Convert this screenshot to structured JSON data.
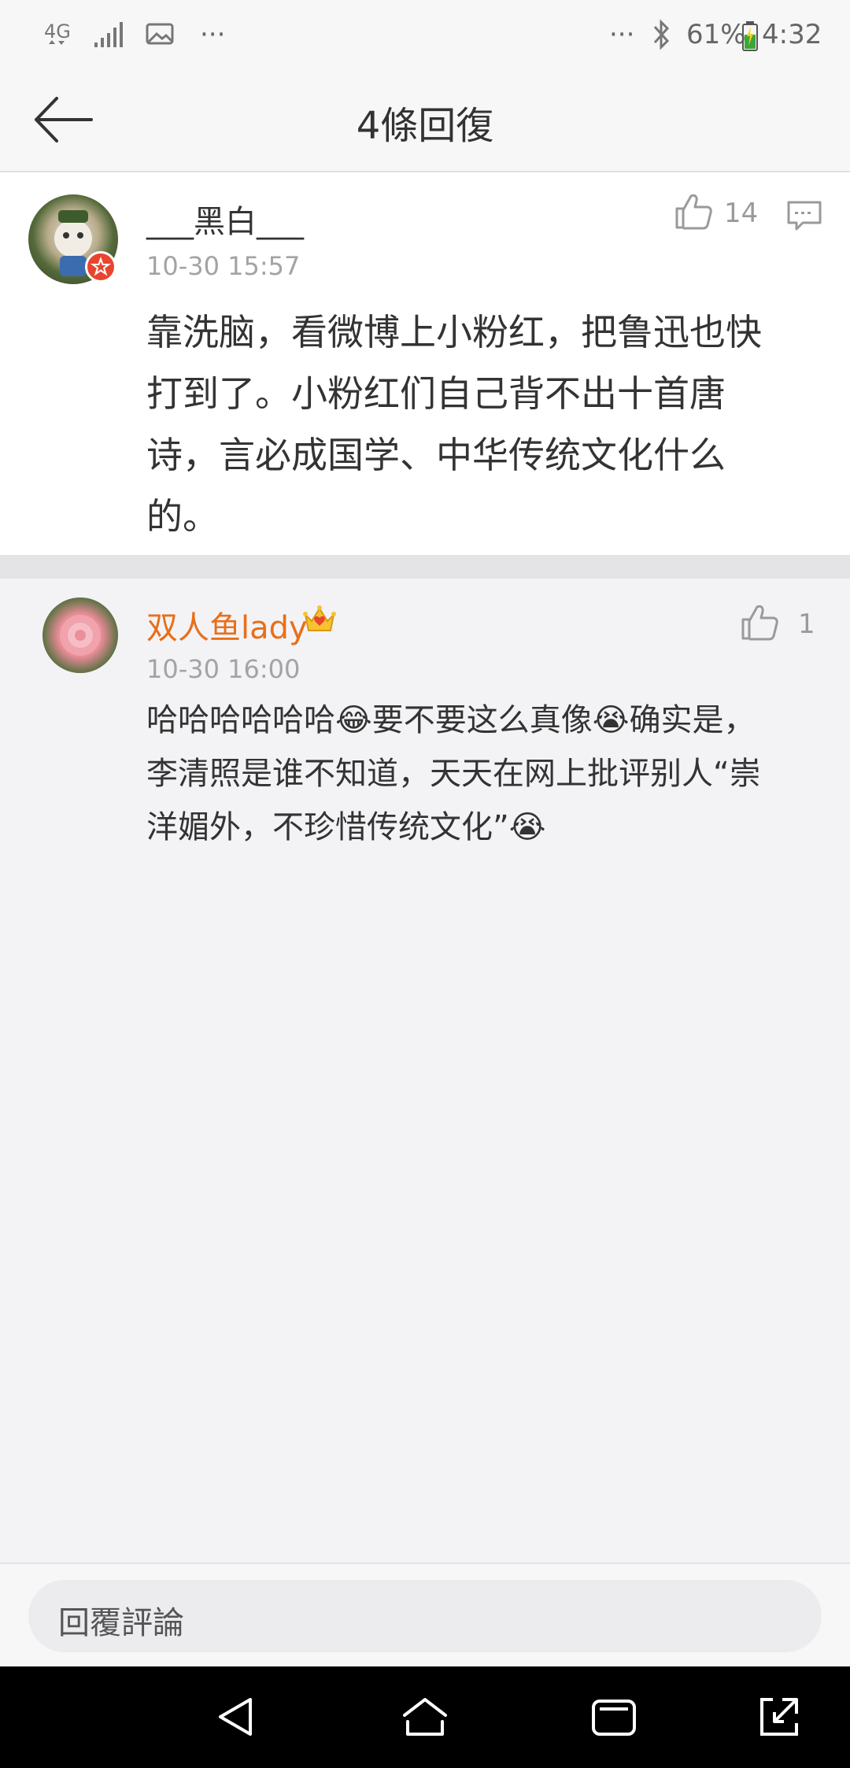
{
  "status_bar": {
    "network_label": "4G",
    "more": "···",
    "more_right": "···",
    "battery": "61%",
    "time": "4:32"
  },
  "header": {
    "title": "4條回復"
  },
  "comments": [
    {
      "username": "___黑白___",
      "timestamp": "10-30 15:57",
      "likes": "14",
      "text_lines": [
        "靠洗脑，看微博上小粉红，把鲁迅也快",
        "打到了。小粉红们自己背不出十首唐",
        "诗，言必成国学、中华传统文化什么",
        "的。"
      ]
    },
    {
      "username": "双人鱼lady",
      "timestamp": "10-30 16:00",
      "likes": "1",
      "username_color": "#e86f1a",
      "text_lines": [
        "哈哈哈哈哈哈😂要不要这么真像😭确实是，",
        "李清照是谁不知道，天天在网上批评别人“崇",
        "洋媚外，不珍惜传统文化”😭"
      ]
    }
  ],
  "reply_bar": {
    "placeholder": "回覆評論"
  },
  "icons": {
    "back": "arrow-left-icon",
    "like": "thumbs-up-icon",
    "comment": "comment-icon",
    "crown": "crown-badge-icon"
  }
}
